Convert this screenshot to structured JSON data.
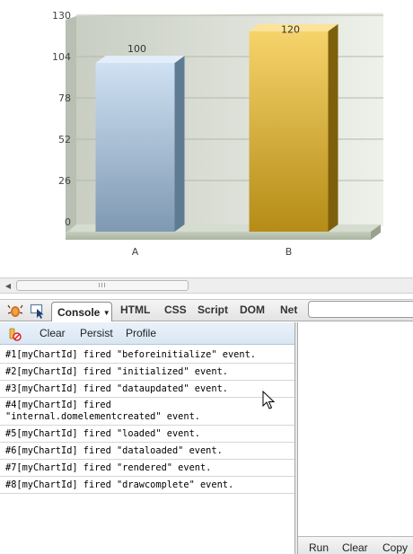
{
  "chart_data": {
    "type": "bar",
    "categories": [
      "A",
      "B"
    ],
    "values": [
      100,
      120
    ],
    "data_labels": [
      "100",
      "120"
    ],
    "y_ticks": [
      "0",
      "26",
      "52",
      "78",
      "104",
      "130"
    ],
    "ylim": [
      0,
      130
    ],
    "grid": true,
    "colors": [
      "#9fbbd6",
      "#e0b637"
    ],
    "title": "",
    "xlabel": "",
    "ylabel": ""
  },
  "scrollbar": {
    "left_arrow": "◀",
    "grip": "III"
  },
  "firebug": {
    "toolbar": {
      "firebug_icon": "firebug-bug-icon",
      "inspect_icon": "inspect-pointer-icon",
      "console_tab": "Console",
      "console_dropdown_icon": "▼",
      "tabs": [
        "HTML",
        "CSS",
        "Script",
        "DOM",
        "Net"
      ],
      "search_placeholder": ""
    },
    "console_toolbar": {
      "clear_icon": "clear-console-icon",
      "clear": "Clear",
      "persist": "Persist",
      "profile": "Profile"
    },
    "log": [
      "#1[myChartId] fired \"beforeinitialize\" event.",
      "#2[myChartId] fired \"initialized\" event.",
      "#3[myChartId] fired \"dataupdated\" event.",
      "#4[myChartId] fired\n\"internal.domelementcreated\" event.",
      "#5[myChartId] fired \"loaded\" event.",
      "#6[myChartId] fired \"dataloaded\" event.",
      "#7[myChartId] fired \"rendered\" event.",
      "#8[myChartId] fired \"drawcomplete\" event."
    ],
    "command_pane": {
      "run": "Run",
      "clear": "Clear",
      "copy": "Copy"
    }
  }
}
